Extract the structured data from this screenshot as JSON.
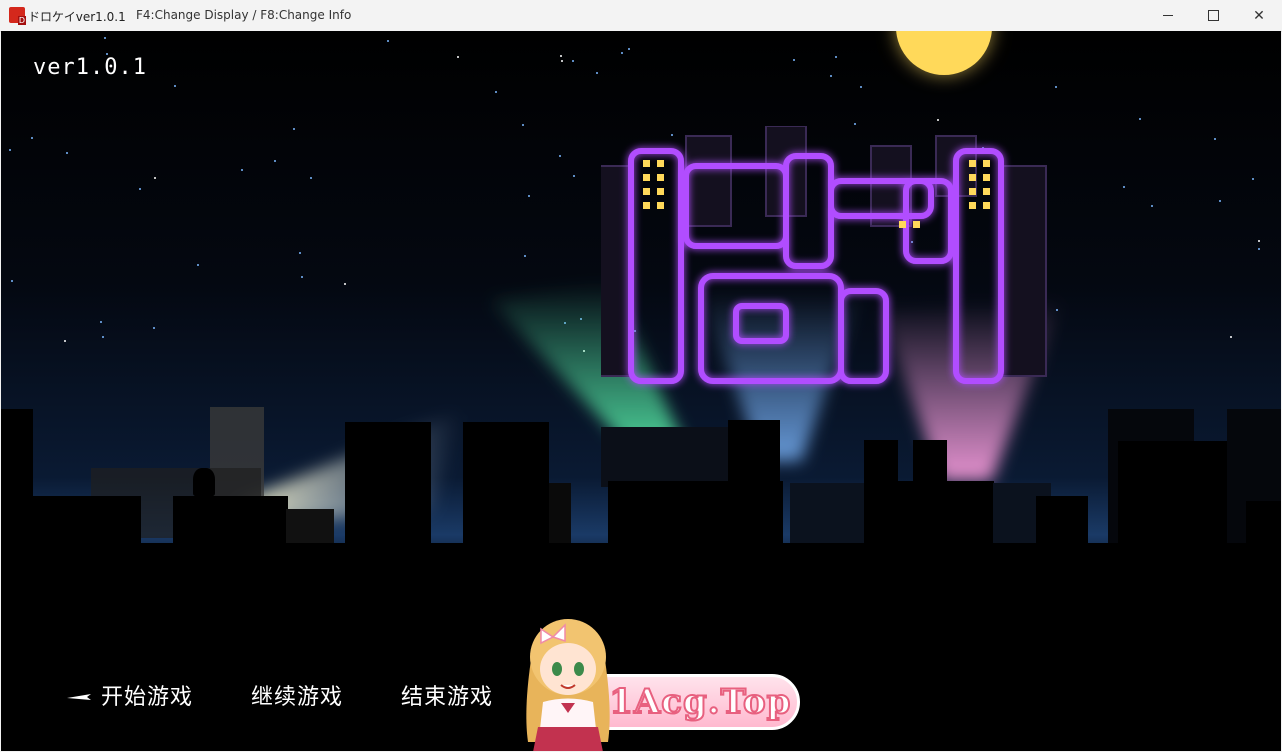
{
  "window": {
    "title": "ドロケイver1.0.1",
    "info": "F4:Change Display / F8:Change Info"
  },
  "game": {
    "version": "ver1.0.1",
    "menu": [
      {
        "label": "开始游戏",
        "selected": true
      },
      {
        "label": "继续游戏",
        "selected": false
      },
      {
        "label": "结束游戏",
        "selected": false
      }
    ],
    "watermark": "91Acg.Top"
  },
  "colors": {
    "moon": "#ffd95a",
    "neon_purple": "#b14dff",
    "beam_green": "#5dffb0",
    "beam_blue": "#7db8ff",
    "beam_pink": "#ff9fe0",
    "banner_pink": "#ffb9cf"
  }
}
